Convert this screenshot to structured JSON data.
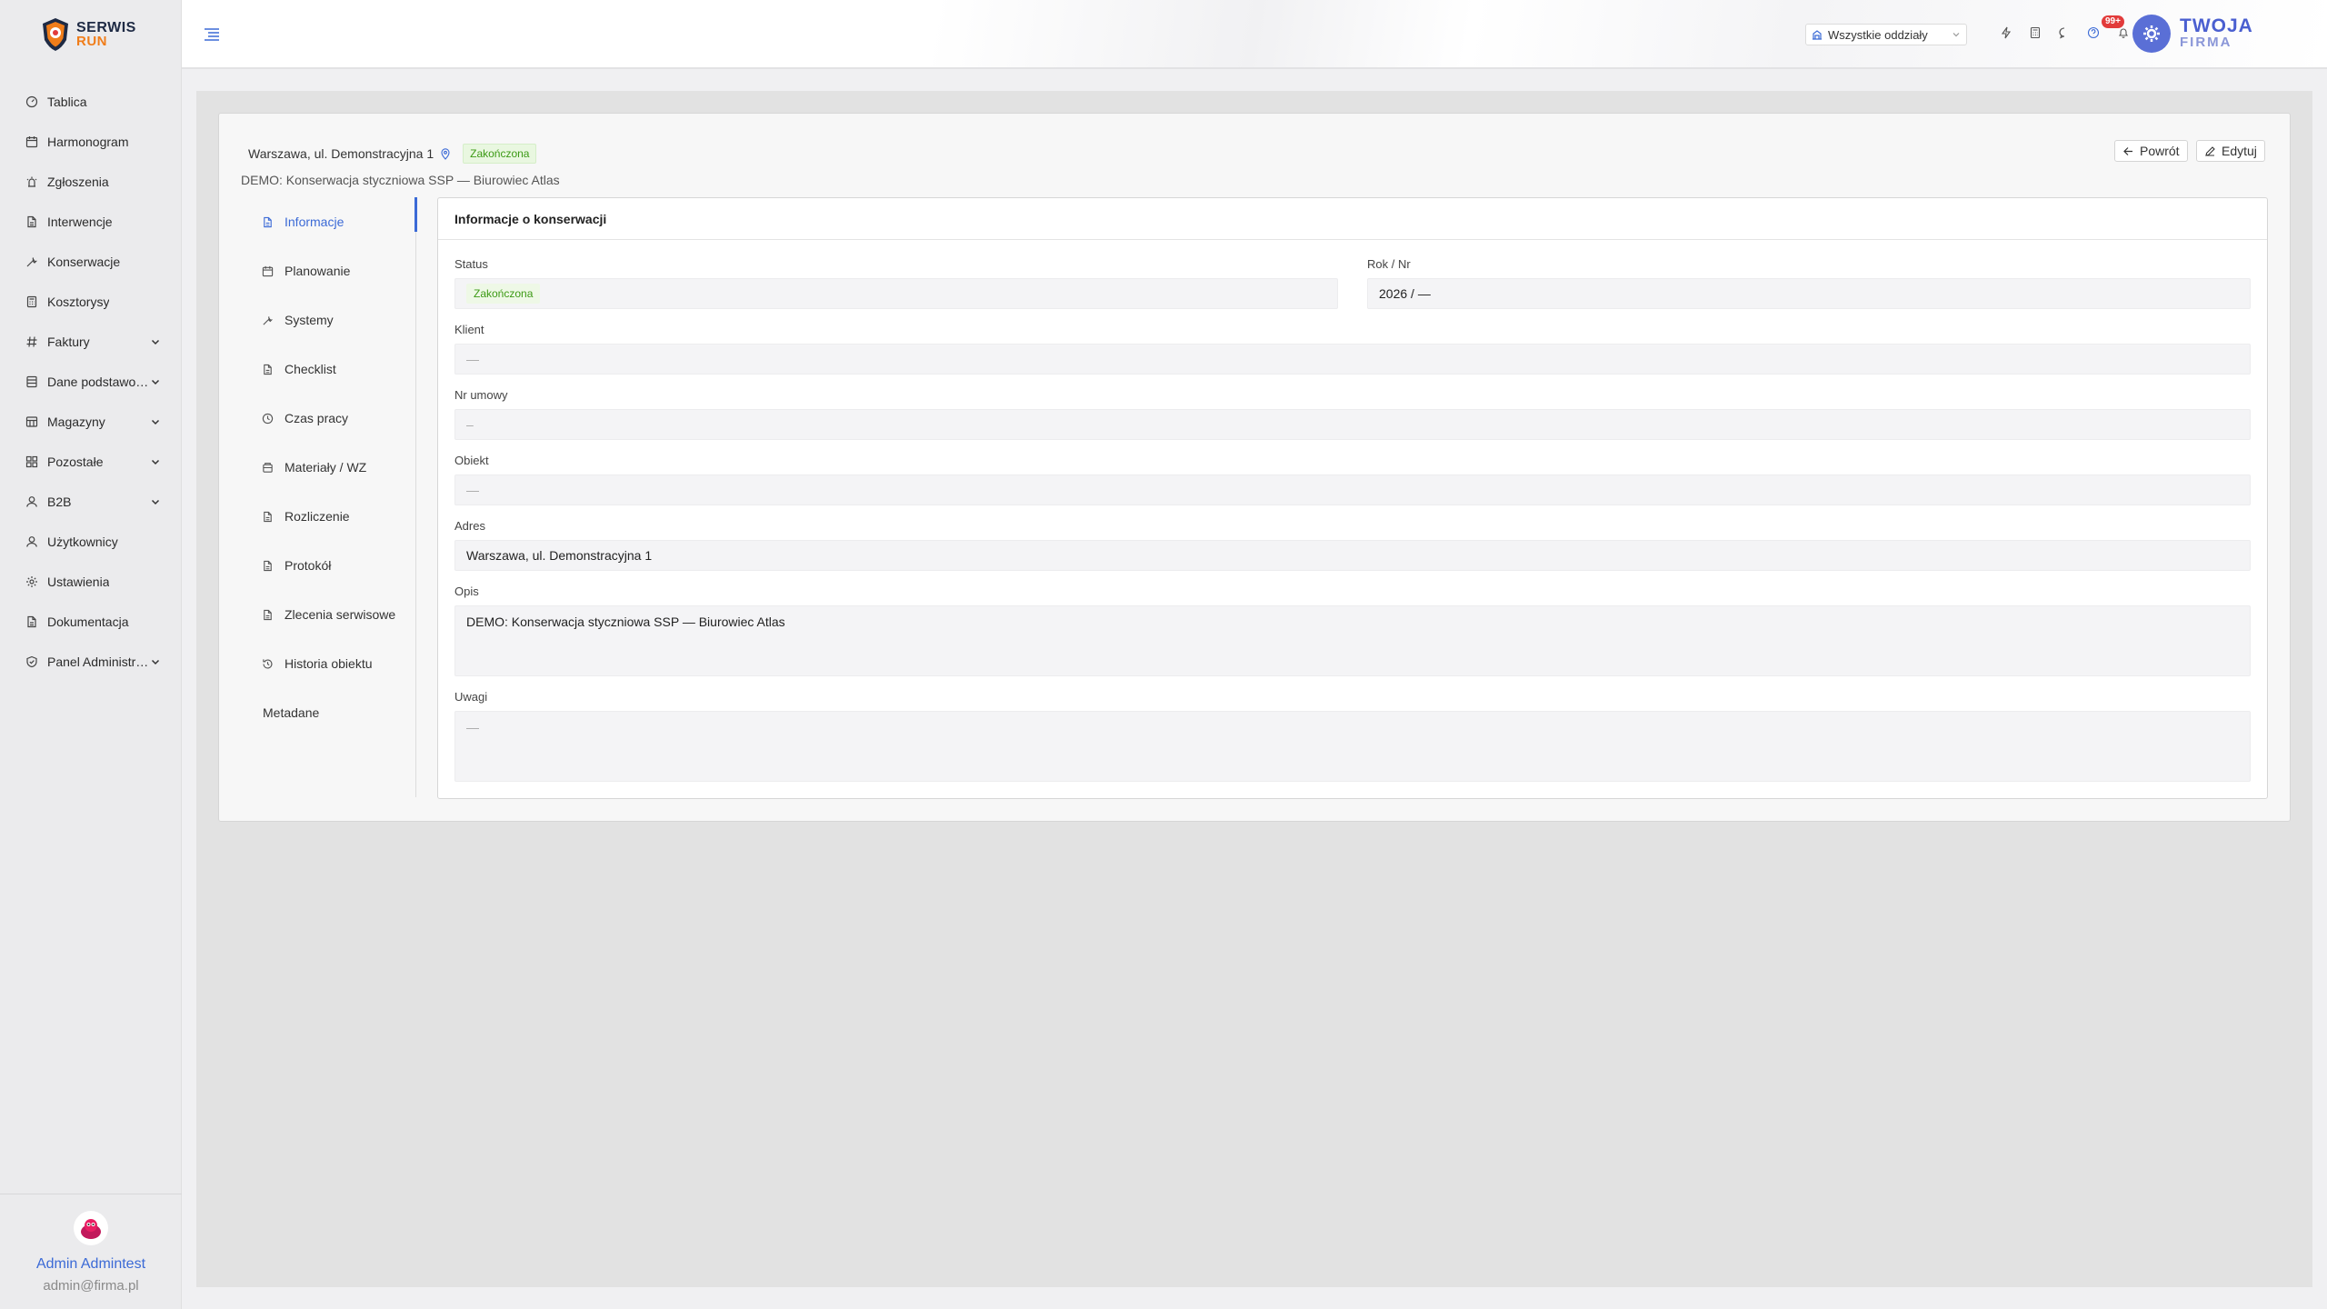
{
  "brand": {
    "line1": "SERWIS",
    "line2": "RUN"
  },
  "nav": [
    {
      "label": "Tablica",
      "icon": "dashboard-icon",
      "chevron": false
    },
    {
      "label": "Harmonogram",
      "icon": "calendar-icon",
      "chevron": false
    },
    {
      "label": "Zgłoszenia",
      "icon": "alarm-icon",
      "chevron": false
    },
    {
      "label": "Interwencje",
      "icon": "document-icon",
      "chevron": false
    },
    {
      "label": "Konserwacje",
      "icon": "wrench-icon",
      "chevron": false
    },
    {
      "label": "Kosztorysy",
      "icon": "calculator-icon",
      "chevron": false
    },
    {
      "label": "Faktury",
      "icon": "hash-icon",
      "chevron": true
    },
    {
      "label": "Dane podstawowe",
      "icon": "database-icon",
      "chevron": true
    },
    {
      "label": "Magazyny",
      "icon": "warehouse-icon",
      "chevron": true
    },
    {
      "label": "Pozostałe",
      "icon": "grid-icon",
      "chevron": true
    },
    {
      "label": "B2B",
      "icon": "user-icon",
      "chevron": true
    },
    {
      "label": "Użytkownicy",
      "icon": "user-icon",
      "chevron": false
    },
    {
      "label": "Ustawienia",
      "icon": "gear-icon",
      "chevron": false
    },
    {
      "label": "Dokumentacja",
      "icon": "document-icon",
      "chevron": false
    },
    {
      "label": "Panel Administratora",
      "icon": "shield-icon",
      "chevron": true
    }
  ],
  "user": {
    "name": "Admin Admintest",
    "email": "admin@firma.pl"
  },
  "header": {
    "branch_select": "Wszystkie oddziały",
    "notifications_badge": "99+",
    "firm_line1": "TWOJA",
    "firm_line2": "FIRMA"
  },
  "page": {
    "address": "Warszawa, ul. Demonstracyjna 1",
    "status_badge": "Zakończona",
    "subtitle": "DEMO: Konserwacja styczniowa SSP — Biurowiec Atlas",
    "back_label": "Powrót",
    "edit_label": "Edytuj"
  },
  "tabs": [
    {
      "label": "Informacje",
      "icon": "document-icon",
      "active": true
    },
    {
      "label": "Planowanie",
      "icon": "calendar-icon",
      "active": false
    },
    {
      "label": "Systemy",
      "icon": "wrench-icon",
      "active": false
    },
    {
      "label": "Checklist",
      "icon": "document-icon",
      "active": false
    },
    {
      "label": "Czas pracy",
      "icon": "clock-icon",
      "active": false
    },
    {
      "label": "Materiały / WZ",
      "icon": "box-icon",
      "active": false
    },
    {
      "label": "Rozliczenie",
      "icon": "document-icon",
      "active": false
    },
    {
      "label": "Protokół",
      "icon": "document-icon",
      "active": false
    },
    {
      "label": "Zlecenia serwisowe",
      "icon": "document-icon",
      "active": false
    },
    {
      "label": "Historia obiektu",
      "icon": "history-icon",
      "active": false
    },
    {
      "label": "Metadane",
      "icon": "",
      "active": false
    }
  ],
  "panel": {
    "title": "Informacje o konserwacji",
    "fields": {
      "status_label": "Status",
      "status_value": "Zakończona",
      "year_label": "Rok / Nr",
      "year_value": "2026 / —",
      "client_label": "Klient",
      "client_value": "—",
      "contract_label": "Nr umowy",
      "contract_value": "–",
      "object_label": "Obiekt",
      "object_value": "—",
      "address_label": "Adres",
      "address_value": "Warszawa, ul. Demonstracyjna 1",
      "desc_label": "Opis",
      "desc_value": "DEMO: Konserwacja styczniowa SSP — Biurowiec Atlas",
      "notes_label": "Uwagi",
      "notes_value": "—"
    }
  }
}
